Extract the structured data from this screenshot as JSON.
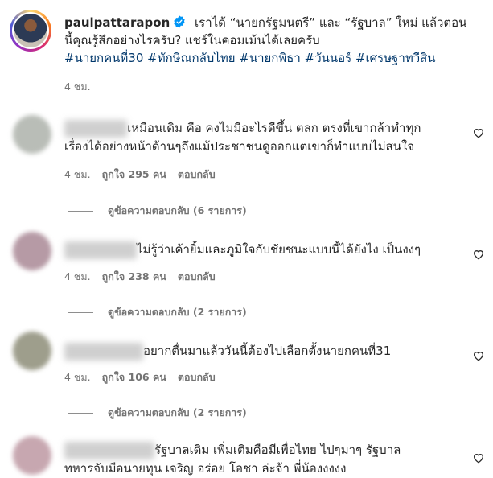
{
  "post": {
    "username": "paulpattarapon",
    "caption": "เราได้ “นายกรัฐมนตรี” และ “รัฐบาล” ใหม่ แล้วตอนนี้คุณรู้สึกอย่างไรครับ? แชร์ในคอมเม้นได้เลยครับ",
    "caption_line1": "เราได้ “นายกรัฐมนตรี” และ “รัฐบาล” ใหม่ แล้วตอน",
    "caption_line2": "นี้คุณรู้สึกอย่างไรครับ? แชร์ในคอมเม้นได้เลยครับ",
    "hashtags": "#นายกคนที่30 #ทักษิณกลับไทย #นายกพิธา #วันนอร์ #เศรษฐาทวีสิน",
    "time": "4 ชม."
  },
  "comments": [
    {
      "text_line1": "เหมือนเดิม คือ คงไม่มีอะไรดีขึ้น ตลก ตรงที่เขากล้าทำทุก",
      "text_line2": "เรื่องได้อย่างหน้าด้านๆถึงแม้ประชาชนดูออกแต่เขาก็ทำแบบไม่สนใจ",
      "time": "4 ชม.",
      "likes": "ถูกใจ 295 คน",
      "reply": "ตอบกลับ",
      "view_replies": "ดูข้อความตอบกลับ (6 รายการ)",
      "avatar_color": "#b9bdb7"
    },
    {
      "text_line1": "ไม่รู้ว่าเค้ายิ้มและภูมิใจกับชัยชนะแบบนี้ได้ยังไง เป็นงงๆ",
      "text_line2": "",
      "time": "4 ชม.",
      "likes": "ถูกใจ 238 คน",
      "reply": "ตอบกลับ",
      "view_replies": "ดูข้อความตอบกลับ (2 รายการ)",
      "avatar_color": "#b69aa5"
    },
    {
      "text_line1": "อยากตื่นมาแล้ววันนี้ต้องไปเลือกตั้งนายกคนที่31",
      "text_line2": "",
      "time": "4 ชม.",
      "likes": "ถูกใจ 106 คน",
      "reply": "ตอบกลับ",
      "view_replies": "ดูข้อความตอบกลับ (2 รายการ)",
      "avatar_color": "#9e9e8c"
    },
    {
      "text_line1": "รัฐบาลเดิม เพิ่มเติมคือมีเพื่อไทย ไปๆมาๆ รัฐบาล",
      "text_line2": "ทหารจับมือนายทุน เจริญ อร่อย โอชา ล่ะจ้า พี่น้องงงงง",
      "avatar_color": "#c7a7b0"
    }
  ],
  "icons": {
    "verified": "verified-badge-icon",
    "heart": "heart-outline-icon"
  },
  "colors": {
    "text": "#262626",
    "muted": "#737373",
    "hashtag": "#00376b",
    "verified": "#0095f6"
  }
}
